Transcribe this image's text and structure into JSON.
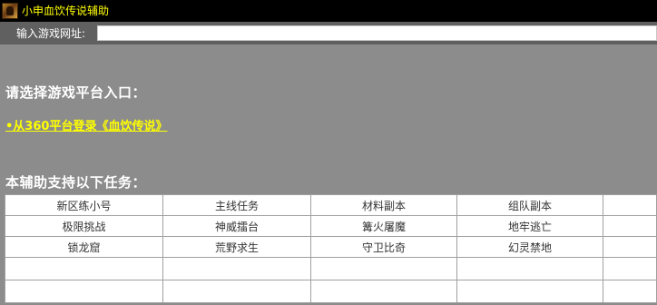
{
  "window": {
    "title": "小申血饮传说辅助",
    "icon": "app-game-icon"
  },
  "urlbar": {
    "label": "输入游戏网址:",
    "value": "",
    "placeholder": ""
  },
  "platform_section": {
    "heading": "请选择游戏平台入口：",
    "link_label": "•从360平台登录《血饮传说》"
  },
  "tasks_section": {
    "heading": "本辅助支持以下任务：",
    "rows": [
      [
        "新区练小号",
        "主线任务",
        "材料副本",
        "组队副本",
        ""
      ],
      [
        "极限挑战",
        "神威擂台",
        "篝火屠魔",
        "地牢逃亡",
        ""
      ],
      [
        "锁龙窟",
        "荒野求生",
        "守卫比奇",
        "幻灵禁地",
        ""
      ],
      [
        "",
        "",
        "",
        "",
        ""
      ],
      [
        "",
        "",
        "",
        "",
        ""
      ]
    ]
  },
  "colors": {
    "title_text": "#ffff00",
    "link": "#ffff00",
    "background": "#8c8c8c",
    "titlebar": "#000000"
  }
}
